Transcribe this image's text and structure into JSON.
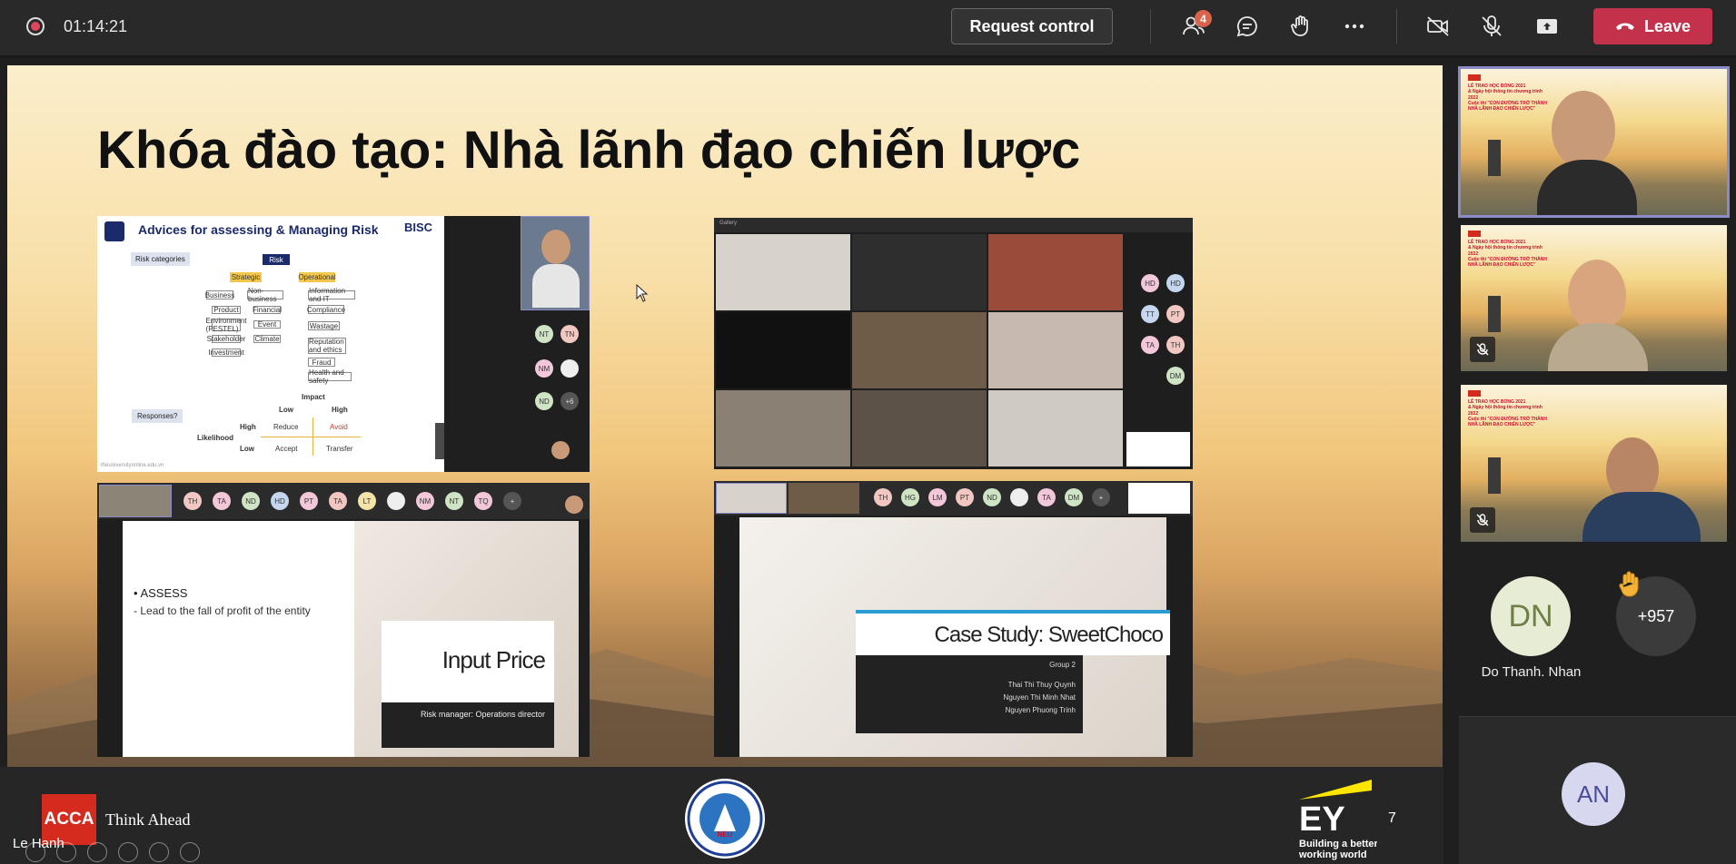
{
  "toolbar": {
    "recording_icon": "record-icon",
    "elapsed_time": "01:14:21",
    "request_control_label": "Request control",
    "participants_badge": "4",
    "leave_label": "Leave",
    "colors": {
      "leave": "#c4314b",
      "badge": "#d9624a",
      "bar": "#292929"
    }
  },
  "slide": {
    "title": "Khóa đào tạo: Nhà lãnh đạo chiến lược",
    "footer": {
      "acca_label": "ACCA",
      "think_ahead": "Think Ahead",
      "university_seal_text": "ĐẠI HỌC KINH TẾ QUỐC DÂN",
      "university_seal_sub": "NEU",
      "ey_logo": "EY",
      "ey_tagline_1": "Building a better",
      "ey_tagline_2": "working world",
      "page_number": "7"
    },
    "presenter_name": "Le Hanh",
    "thumbs": {
      "risk": {
        "heading": "Advices for assessing & Managing Risk",
        "brand": "BISC",
        "risk_categories": "Risk categories",
        "tree_root": "Risk",
        "tree_level1": [
          "Strategic",
          "Operational"
        ],
        "tree_level2": [
          "Business",
          "Non-business",
          "Information and IT",
          "Compliance",
          "Wastage",
          "Reputation and ethics",
          "Fraud",
          "Health and safety"
        ],
        "tree_business": [
          "Product",
          "Environment (PESTEL)",
          "Stakeholder",
          "Investment"
        ],
        "tree_nonbusiness": [
          "Financial",
          "Event",
          "Climate"
        ],
        "responses": "Responses?",
        "impact": "Impact",
        "likelihood": "Likelihood",
        "low": "Low",
        "high": "High",
        "matrix": [
          "Reduce",
          "Avoid",
          "Accept",
          "Transfer"
        ],
        "website": "theuniversityonline.edu.vn",
        "avatars": [
          "NT",
          "TN",
          "NM",
          "ND",
          "+6"
        ]
      },
      "gallery": {
        "top_label": "Gallery",
        "avatars": [
          "HD",
          "HD",
          "TT",
          "PT",
          "TA",
          "TH",
          "DM"
        ]
      },
      "assess": {
        "bullet": "ASSESS",
        "line": "Lead to the fall of profit of the entity",
        "card_title": "Input Price",
        "card_sub": "Risk manager: Operations director",
        "avatars": [
          "TH",
          "TA",
          "ND",
          "HD",
          "PT",
          "TA",
          "LT",
          "NM",
          "NT",
          "TQ",
          "+"
        ]
      },
      "case": {
        "title": "Case Study: SweetChoco",
        "group": "Group 2",
        "members": [
          "Thai Thi Thuy Quynh",
          "Nguyen Thi Minh Nhat",
          "Nguyen Phuong Trinh"
        ],
        "avatars": [
          "TH",
          "HG",
          "LM",
          "PT",
          "ND",
          "TA",
          "DM",
          "+"
        ]
      }
    }
  },
  "sidebar": {
    "tile_slide_line1": "LỄ TRAO HỌC BỔNG 2021",
    "tile_slide_line2": "& Ngày hội thông tin chương trình 2022",
    "tile_slide_line3": "Cuộc thi \"CON ĐƯỜNG TRỞ THÀNH",
    "tile_slide_line4": "NHÀ LÃNH ĐẠO CHIẾN LƯỢC\"",
    "participant_dn_initials": "DN",
    "participant_dn_name": "Do Thanh. Nhan",
    "overflow_count": "+957",
    "raised_hand_icon": "raised-hand-icon",
    "participant_an_initials": "AN"
  }
}
